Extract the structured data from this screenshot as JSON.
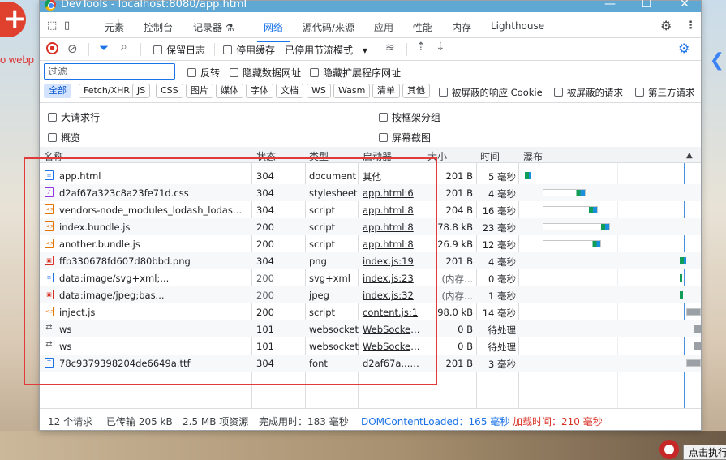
{
  "window": {
    "title": "DevTools - localhost:8080/app.html",
    "controls": [
      "—",
      "☐",
      "✕"
    ]
  },
  "background": {
    "left_text": "o webp",
    "exec_button": "点击执行"
  },
  "tabs": [
    {
      "label": "元素"
    },
    {
      "label": "控制台"
    },
    {
      "label": "记录器 ⚗"
    },
    {
      "label": "网络",
      "active": true
    },
    {
      "label": "源代码/来源"
    },
    {
      "label": "应用"
    },
    {
      "label": "性能"
    },
    {
      "label": "内存"
    },
    {
      "label": "Lighthouse"
    }
  ],
  "toolbar": {
    "preserve_log": "保留日志",
    "disable_cache": "停用缓存",
    "throttle": "已停用节流模式"
  },
  "filter": {
    "placeholder": "过滤",
    "invert": "反转",
    "hide_data_urls": "隐藏数据网址",
    "hide_extension_urls": "隐藏扩展程序网址"
  },
  "type_filters": [
    "全部",
    "Fetch/XHR",
    "JS",
    "CSS",
    "图片",
    "媒体",
    "字体",
    "文档",
    "WS",
    "Wasm",
    "清单",
    "其他"
  ],
  "blocked_cookies": "被屏蔽的响应 Cookie",
  "blocked_requests": "被屏蔽的请求",
  "third_party": "第三方请求",
  "options": {
    "big_rows": "大请求行",
    "overview": "概览",
    "group_by_frame": "按框架分组",
    "screenshots": "屏幕截图"
  },
  "columns": {
    "name": "名称",
    "status": "状态",
    "type": "类型",
    "initiator": "启动器",
    "size": "大小",
    "time": "时间",
    "waterfall": "瀑布"
  },
  "requests": [
    {
      "name": "app.html",
      "status": "304",
      "type": "document",
      "initiator": "其他",
      "initiator_link": false,
      "size": "201 B",
      "time": "5 毫秒",
      "icon": "doc",
      "wf": [
        0.01,
        0.04
      ]
    },
    {
      "name": "d2af67a323c8a23fe71d.css",
      "status": "304",
      "type": "stylesheet",
      "initiator": "app.html:6",
      "initiator_link": true,
      "size": "201 B",
      "time": "4 毫秒",
      "icon": "css",
      "wf": [
        0.11,
        0.35
      ]
    },
    {
      "name": "vendors-node_modules_lodash_lodash_js-...",
      "status": "304",
      "type": "script",
      "initiator": "app.html:8",
      "initiator_link": true,
      "size": "204 B",
      "time": "16 毫秒",
      "icon": "js",
      "wf": [
        0.11,
        0.42
      ]
    },
    {
      "name": "index.bundle.js",
      "status": "200",
      "type": "script",
      "initiator": "app.html:8",
      "initiator_link": true,
      "size": "78.8 kB",
      "time": "23 毫秒",
      "icon": "js",
      "wf": [
        0.11,
        0.49
      ]
    },
    {
      "name": "another.bundle.js",
      "status": "200",
      "type": "script",
      "initiator": "app.html:8",
      "initiator_link": true,
      "size": "26.9 kB",
      "time": "12 毫秒",
      "icon": "js",
      "wf": [
        0.11,
        0.44
      ]
    },
    {
      "name": "ffb330678fd607d80bbd.png",
      "status": "304",
      "type": "png",
      "initiator": "index.js:19",
      "initiator_link": true,
      "size": "201 B",
      "time": "4 毫秒",
      "icon": "img",
      "wf": [
        0.88,
        0.92
      ]
    },
    {
      "name": "data:image/svg+xml;...",
      "status": "200",
      "status_gray": true,
      "type": "svg+xml",
      "initiator": "index.js:23",
      "initiator_link": true,
      "size": "(内存...",
      "size_gray": true,
      "time": "0 毫秒",
      "icon": "doc",
      "wf": [
        0.88,
        0.89
      ]
    },
    {
      "name": "data:image/jpeg;bas...",
      "status": "200",
      "status_gray": true,
      "type": "jpeg",
      "initiator": "index.js:32",
      "initiator_link": true,
      "size": "(内存...",
      "size_gray": true,
      "time": "1 毫秒",
      "icon": "img",
      "wf": [
        0.88,
        0.9
      ]
    },
    {
      "name": "inject.js",
      "status": "200",
      "type": "script",
      "initiator": "content.js:1",
      "initiator_link": true,
      "size": "98.0 kB",
      "time": "14 毫秒",
      "icon": "js",
      "wf": [
        0.92,
        1.0
      ]
    },
    {
      "name": "ws",
      "status": "101",
      "type": "websocket",
      "initiator": "WebSocket...",
      "initiator_link": true,
      "size": "0 B",
      "time": "待处理",
      "icon": "ws",
      "wf": [
        0.96,
        1.0
      ]
    },
    {
      "name": "ws",
      "status": "101",
      "type": "websocket",
      "initiator": "WebSocket...",
      "initiator_link": true,
      "size": "0 B",
      "time": "待处理",
      "icon": "ws",
      "wf": [
        0.96,
        1.0
      ]
    },
    {
      "name": "78c9379398204de6649a.ttf",
      "status": "304",
      "type": "font",
      "initiator": "d2af67a....css",
      "initiator_link": true,
      "size": "201 B",
      "time": "3 毫秒",
      "icon": "font",
      "wf": [
        0.92,
        1.0
      ]
    }
  ],
  "status": {
    "requests": "12 个请求",
    "transferred": "已传输 205 kB",
    "resources": "2.5 MB 项资源",
    "finish": "完成用时：183 毫秒",
    "dcl": "DOMContentLoaded：165 毫秒",
    "load": "加载时间：210 毫秒"
  },
  "colors": {
    "accent": "#1a73e8",
    "highlight": "#e03a3a",
    "wf_green": "#0f9d58",
    "wf_blue": "#1a8fdc"
  }
}
